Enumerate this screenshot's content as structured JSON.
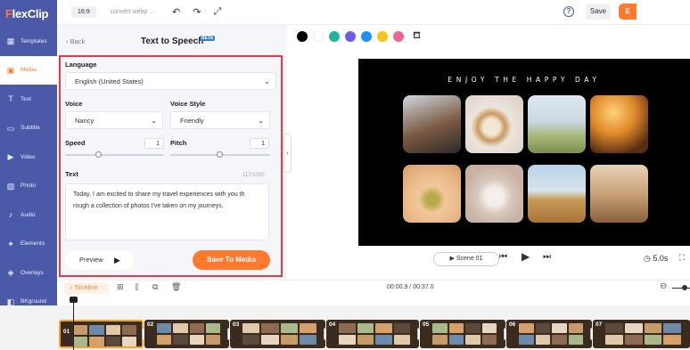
{
  "app": {
    "logo_left": "F",
    "logo_rest": "lexClip"
  },
  "sidebar": {
    "items": [
      {
        "label": "Templates",
        "icon": "templates-icon",
        "glyph": "▦"
      },
      {
        "label": "Media",
        "icon": "media-icon",
        "glyph": "▣"
      },
      {
        "label": "Text",
        "icon": "text-icon",
        "glyph": "T"
      },
      {
        "label": "Subtitle",
        "icon": "subtitle-icon",
        "glyph": "▭"
      },
      {
        "label": "Video",
        "icon": "video-icon",
        "glyph": "▶"
      },
      {
        "label": "Photo",
        "icon": "photo-icon",
        "glyph": "▨"
      },
      {
        "label": "Audio",
        "icon": "audio-icon",
        "glyph": "♪"
      },
      {
        "label": "Elements",
        "icon": "elements-icon",
        "glyph": "✦"
      },
      {
        "label": "Overlays",
        "icon": "overlays-icon",
        "glyph": "◈"
      },
      {
        "label": "BKground",
        "icon": "background-icon",
        "glyph": "◧"
      },
      {
        "label": "Tools",
        "icon": "tools-icon",
        "glyph": "⚒"
      }
    ]
  },
  "topbar": {
    "ratio": "16:9",
    "project_name": "convert webp ...",
    "help": "?",
    "save_label": "Save",
    "export_label": "E"
  },
  "panel": {
    "back_label": "Back",
    "title": "Text to Speech",
    "beta": "BETA",
    "language_label": "Language",
    "language_value": "English (United States)",
    "voice_label": "Voice",
    "voice_value": "Nancy",
    "voice_style_label": "Voice Style",
    "voice_style_value": "Friendly",
    "speed_label": "Speed",
    "speed_value": "1",
    "pitch_label": "Pitch",
    "pitch_value": "1",
    "text_label": "Text",
    "text_counter": "117/1000",
    "text_body": "Today, I am excited to share my travel experiences with you th rough a collection of photos I've taken on my journeys.",
    "preview_label": "Preview",
    "save_media_label": "Save To Media"
  },
  "color_palette": [
    "#000000",
    "#ffffff",
    "#1fb5a0",
    "#6c5ce7",
    "#1e90ff",
    "#f5c518",
    "#f06292"
  ],
  "stage": {
    "title": "ENJOY THE HAPPY DAY",
    "background": "#000000"
  },
  "player": {
    "scene_label": "Scene 01",
    "duration": "5.0s"
  },
  "timeline": {
    "tag_label": "Timeline",
    "timecode": "00:00.9 / 00:37.0",
    "clips": [
      {
        "num": "01"
      },
      {
        "num": "02"
      },
      {
        "num": "03"
      },
      {
        "num": "04"
      },
      {
        "num": "05"
      },
      {
        "num": "06"
      },
      {
        "num": "07"
      }
    ]
  },
  "colors": {
    "accent": "#ff7a2f",
    "sidebar": "#4b5aa8",
    "highlight_box": "#e63946"
  }
}
